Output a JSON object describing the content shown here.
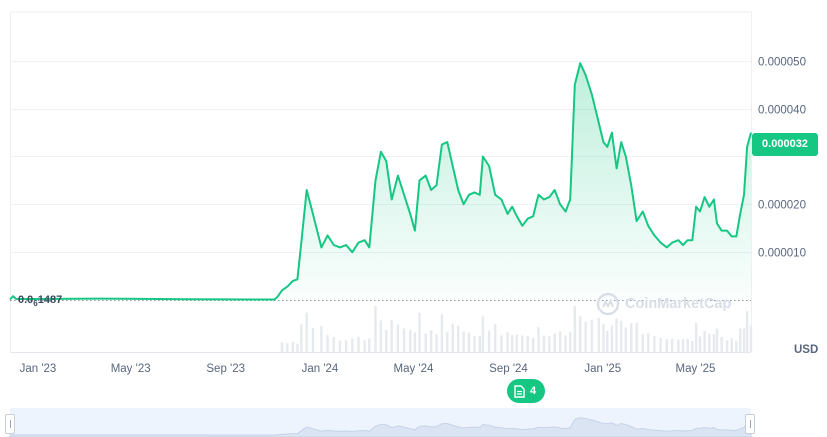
{
  "chart_data": {
    "type": "area",
    "currency": "USD",
    "y_ticks": [
      "0.000010",
      "0.000020",
      "0.000040",
      "0.000050"
    ],
    "y_tick_values": [
      1e-05,
      2e-05,
      4e-05,
      5e-05
    ],
    "ylim": [
      0,
      6.02e-05
    ],
    "x_tick_labels": [
      "Jan '23",
      "May '23",
      "Sep '23",
      "Jan '24",
      "May '24",
      "Sep '24",
      "Jan '25",
      "May '25"
    ],
    "x_tick_dates": [
      "2023-01-01",
      "2023-05-01",
      "2023-09-01",
      "2024-01-01",
      "2024-05-01",
      "2024-09-01",
      "2025-01-01",
      "2025-05-01"
    ],
    "x_range": [
      "2022-12-01",
      "2025-07-17"
    ],
    "current_price_label": "0.000032",
    "current_price": 3.2e-05,
    "baseline_label": {
      "main": "0.0",
      "sub": "6",
      "tail": "1487"
    },
    "baseline_value": 1.487e-07,
    "series": [
      {
        "points": [
          [
            "2022-12-01",
            1e-07
          ],
          [
            "2022-12-05",
            8e-07
          ],
          [
            "2022-12-09",
            2e-07
          ],
          [
            "2022-12-20",
            2.1e-07
          ],
          [
            "2023-01-15",
            2e-07
          ],
          [
            "2023-02-20",
            2.5e-07
          ],
          [
            "2023-03-25",
            3e-07
          ],
          [
            "2023-05-01",
            2.8e-07
          ],
          [
            "2023-06-10",
            2e-07
          ],
          [
            "2023-07-20",
            1.5e-07
          ],
          [
            "2023-09-01",
            1.2e-07
          ],
          [
            "2023-10-15",
            1e-07
          ],
          [
            "2023-11-08",
            1e-07
          ],
          [
            "2023-11-12",
            6e-07
          ],
          [
            "2023-11-18",
            2e-06
          ],
          [
            "2023-11-25",
            2.8e-06
          ],
          [
            "2023-12-02",
            4e-06
          ],
          [
            "2023-12-08",
            4.3e-06
          ],
          [
            "2023-12-13",
            1.2e-05
          ],
          [
            "2023-12-20",
            2.3e-05
          ],
          [
            "2023-12-28",
            1.8e-05
          ],
          [
            "2024-01-08",
            1.1e-05
          ],
          [
            "2024-01-16",
            1.35e-05
          ],
          [
            "2024-01-24",
            1.15e-05
          ],
          [
            "2024-02-01",
            1.1e-05
          ],
          [
            "2024-02-09",
            1.15e-05
          ],
          [
            "2024-02-17",
            1e-05
          ],
          [
            "2024-02-25",
            1.2e-05
          ],
          [
            "2024-03-04",
            1.25e-05
          ],
          [
            "2024-03-10",
            1.1e-05
          ],
          [
            "2024-03-18",
            2.5e-05
          ],
          [
            "2024-03-25",
            3.1e-05
          ],
          [
            "2024-04-01",
            2.9e-05
          ],
          [
            "2024-04-08",
            2.1e-05
          ],
          [
            "2024-04-16",
            2.6e-05
          ],
          [
            "2024-04-24",
            2.2e-05
          ],
          [
            "2024-05-02",
            1.8e-05
          ],
          [
            "2024-05-08",
            1.45e-05
          ],
          [
            "2024-05-14",
            2.5e-05
          ],
          [
            "2024-05-22",
            2.6e-05
          ],
          [
            "2024-05-29",
            2.3e-05
          ],
          [
            "2024-06-05",
            2.4e-05
          ],
          [
            "2024-06-12",
            3.25e-05
          ],
          [
            "2024-06-19",
            3.3e-05
          ],
          [
            "2024-06-26",
            2.8e-05
          ],
          [
            "2024-07-03",
            2.3e-05
          ],
          [
            "2024-07-10",
            2e-05
          ],
          [
            "2024-07-17",
            2.2e-05
          ],
          [
            "2024-07-24",
            2.25e-05
          ],
          [
            "2024-07-31",
            2.2e-05
          ],
          [
            "2024-08-04",
            3e-05
          ],
          [
            "2024-08-12",
            2.8e-05
          ],
          [
            "2024-08-20",
            2.2e-05
          ],
          [
            "2024-08-28",
            2.1e-05
          ],
          [
            "2024-09-05",
            1.8e-05
          ],
          [
            "2024-09-11",
            1.95e-05
          ],
          [
            "2024-09-17",
            1.75e-05
          ],
          [
            "2024-09-24",
            1.55e-05
          ],
          [
            "2024-10-01",
            1.7e-05
          ],
          [
            "2024-10-08",
            1.75e-05
          ],
          [
            "2024-10-15",
            2.2e-05
          ],
          [
            "2024-10-22",
            2.1e-05
          ],
          [
            "2024-10-29",
            2.15e-05
          ],
          [
            "2024-11-05",
            2.3e-05
          ],
          [
            "2024-11-12",
            2e-05
          ],
          [
            "2024-11-19",
            1.85e-05
          ],
          [
            "2024-11-25",
            2.1e-05
          ],
          [
            "2024-12-01",
            4.5e-05
          ],
          [
            "2024-12-08",
            4.95e-05
          ],
          [
            "2024-12-15",
            4.7e-05
          ],
          [
            "2024-12-23",
            4.3e-05
          ],
          [
            "2025-01-01",
            3.7e-05
          ],
          [
            "2025-01-07",
            3.3e-05
          ],
          [
            "2025-01-12",
            3.2e-05
          ],
          [
            "2025-01-18",
            3.5e-05
          ],
          [
            "2025-01-24",
            2.75e-05
          ],
          [
            "2025-01-30",
            3.3e-05
          ],
          [
            "2025-02-05",
            3e-05
          ],
          [
            "2025-02-12",
            2.4e-05
          ],
          [
            "2025-02-19",
            1.65e-05
          ],
          [
            "2025-02-27",
            1.85e-05
          ],
          [
            "2025-03-06",
            1.55e-05
          ],
          [
            "2025-03-14",
            1.35e-05
          ],
          [
            "2025-03-22",
            1.2e-05
          ],
          [
            "2025-03-30",
            1.1e-05
          ],
          [
            "2025-04-06",
            1.2e-05
          ],
          [
            "2025-04-14",
            1.25e-05
          ],
          [
            "2025-04-20",
            1.15e-05
          ],
          [
            "2025-04-26",
            1.25e-05
          ],
          [
            "2025-05-02",
            1.25e-05
          ],
          [
            "2025-05-07",
            1.95e-05
          ],
          [
            "2025-05-12",
            1.85e-05
          ],
          [
            "2025-05-18",
            2.15e-05
          ],
          [
            "2025-05-24",
            1.95e-05
          ],
          [
            "2025-05-30",
            2.1e-05
          ],
          [
            "2025-06-03",
            1.6e-05
          ],
          [
            "2025-06-09",
            1.45e-05
          ],
          [
            "2025-06-16",
            1.45e-05
          ],
          [
            "2025-06-22",
            1.33e-05
          ],
          [
            "2025-06-28",
            1.33e-05
          ],
          [
            "2025-07-03",
            1.8e-05
          ],
          [
            "2025-07-08",
            2.2e-05
          ],
          [
            "2025-07-12",
            3.2e-05
          ],
          [
            "2025-07-17",
            3.5e-05
          ]
        ]
      }
    ],
    "line_color": "#16c784",
    "grid": true
  },
  "labels": {
    "currency": "USD",
    "price_badge": "0.000032",
    "news_count": "4",
    "watermark": "CoinMarketCap"
  },
  "icons": [
    "document-icon",
    "coinmarketcap-logo-icon"
  ]
}
